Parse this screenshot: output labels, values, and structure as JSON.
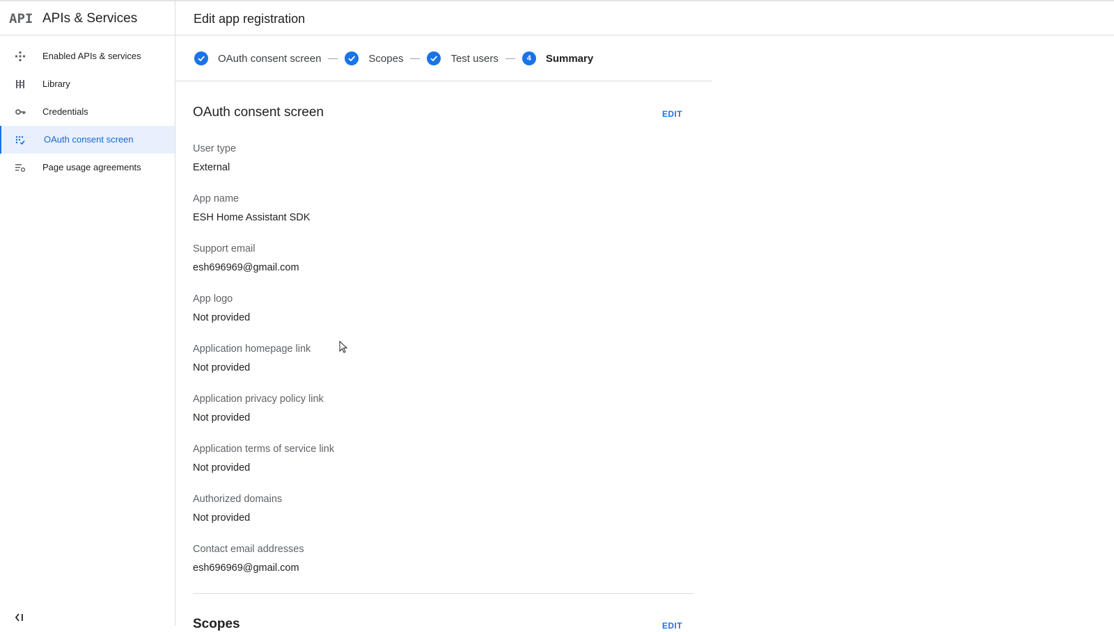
{
  "app": {
    "logo_text": "API",
    "title": "APIs & Services"
  },
  "sidebar": {
    "items": [
      {
        "label": "Enabled APIs & services",
        "icon": "enabled-apis-icon"
      },
      {
        "label": "Library",
        "icon": "library-icon"
      },
      {
        "label": "Credentials",
        "icon": "key-icon"
      },
      {
        "label": "OAuth consent screen",
        "icon": "consent-screen-icon",
        "active": true
      },
      {
        "label": "Page usage agreements",
        "icon": "settings-list-icon"
      }
    ],
    "collapse_icon": "collapse-sidebar-icon"
  },
  "header": {
    "title": "Edit app registration"
  },
  "stepper": {
    "steps": [
      {
        "label": "OAuth consent screen",
        "state": "done"
      },
      {
        "label": "Scopes",
        "state": "done"
      },
      {
        "label": "Test users",
        "state": "done"
      },
      {
        "label": "Summary",
        "state": "current",
        "number": "4"
      }
    ]
  },
  "summary": {
    "section_title": "OAuth consent screen",
    "edit_label": "EDIT",
    "fields": [
      {
        "label": "User type",
        "value": "External"
      },
      {
        "label": "App name",
        "value": "ESH Home Assistant SDK"
      },
      {
        "label": "Support email",
        "value": "esh696969@gmail.com"
      },
      {
        "label": "App logo",
        "value": "Not provided"
      },
      {
        "label": "Application homepage link",
        "value": "Not provided"
      },
      {
        "label": "Application privacy policy link",
        "value": "Not provided"
      },
      {
        "label": "Application terms of service link",
        "value": "Not provided"
      },
      {
        "label": "Authorized domains",
        "value": "Not provided"
      },
      {
        "label": "Contact email addresses",
        "value": "esh696969@gmail.com"
      }
    ],
    "next_section_title": "Scopes",
    "next_edit_label": "EDIT"
  },
  "colors": {
    "accent": "#1a73e8",
    "active_bg": "#e8f0fe",
    "muted": "#5f6368"
  }
}
